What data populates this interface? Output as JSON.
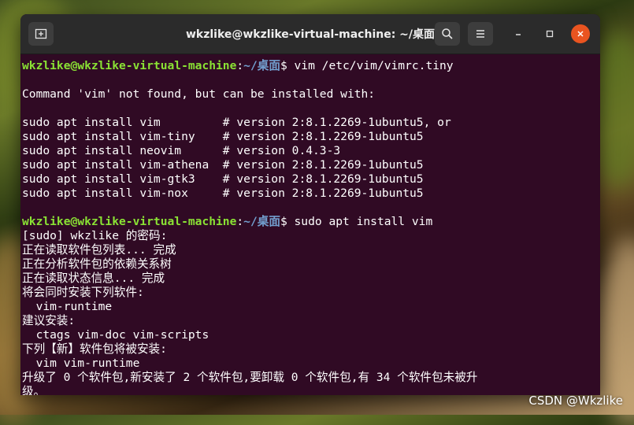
{
  "window": {
    "title": "wkzlike@wkzlike-virtual-machine: ~/桌面"
  },
  "icons": {
    "new_tab": "new-tab-icon",
    "search": "search-icon",
    "menu": "hamburger-menu-icon",
    "minimize": "minimize-icon",
    "maximize": "maximize-icon",
    "close": "close-icon"
  },
  "prompt": {
    "user_host": "wkzlike@wkzlike-virtual-machine",
    "colon": ":",
    "path": "~/桌面",
    "dollar": "$ "
  },
  "commands": {
    "first": "vim /etc/vim/vimrc.tiny",
    "second": "sudo apt install vim"
  },
  "output1": [
    "",
    "Command 'vim' not found, but can be installed with:",
    "",
    "sudo apt install vim         # version 2:8.1.2269-1ubuntu5, or",
    "sudo apt install vim-tiny    # version 2:8.1.2269-1ubuntu5",
    "sudo apt install neovim      # version 0.4.3-3",
    "sudo apt install vim-athena  # version 2:8.1.2269-1ubuntu5",
    "sudo apt install vim-gtk3    # version 2:8.1.2269-1ubuntu5",
    "sudo apt install vim-nox     # version 2:8.1.2269-1ubuntu5",
    ""
  ],
  "output2": [
    "[sudo] wkzlike 的密码:",
    "正在读取软件包列表... 完成",
    "正在分析软件包的依赖关系树",
    "正在读取状态信息... 完成",
    "将会同时安装下列软件:",
    "  vim-runtime",
    "建议安装:",
    "  ctags vim-doc vim-scripts",
    "下列【新】软件包将被安装:",
    "  vim vim-runtime",
    "升级了 0 个软件包,新安装了 2 个软件包,要卸载 0 个软件包,有 34 个软件包未被升",
    "级。"
  ],
  "watermark": "CSDN @Wkzlike",
  "colors": {
    "terminal_bg": "#300a24",
    "prompt_user": "#8ae234",
    "prompt_path": "#729fcf",
    "close_button": "#e95420"
  }
}
